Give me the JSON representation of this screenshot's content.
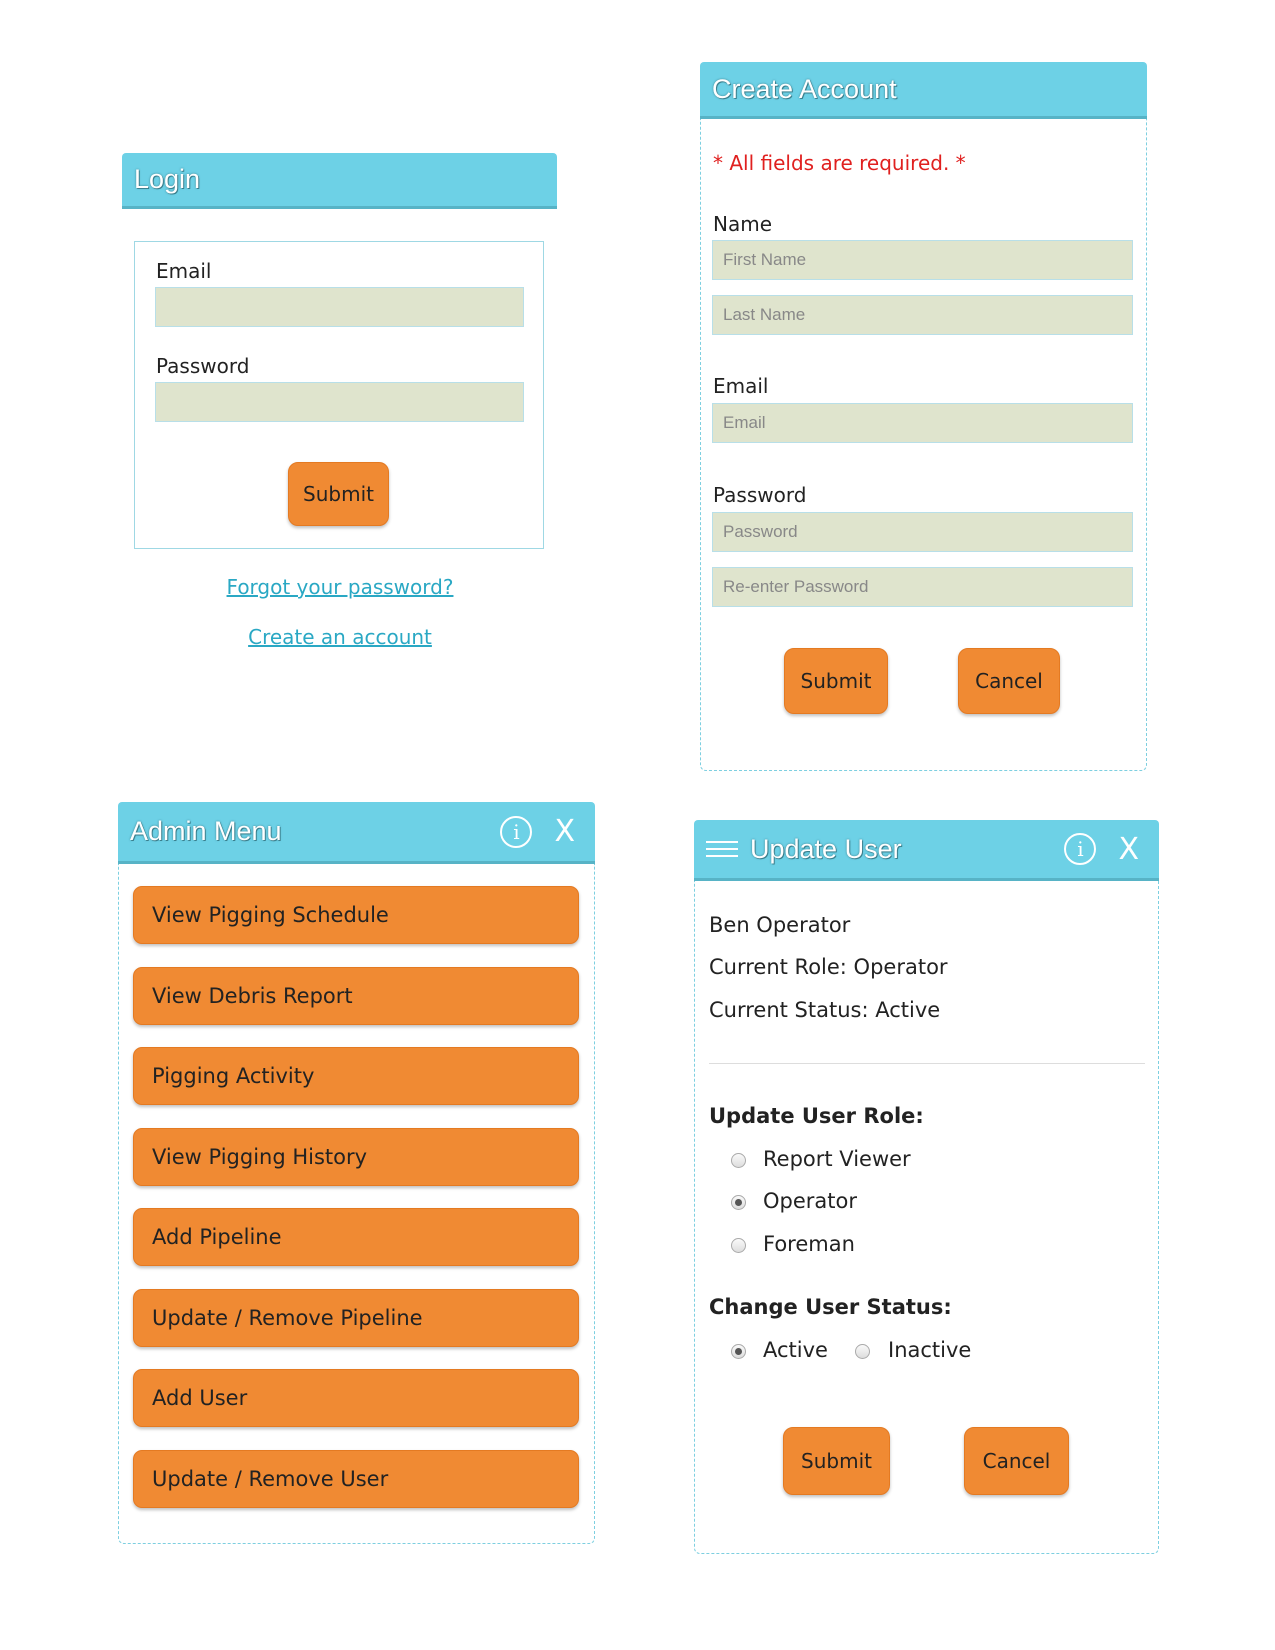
{
  "login": {
    "title": "Login",
    "email_label": "Email",
    "email_value": "",
    "password_label": "Password",
    "password_value": "",
    "submit_label": "Submit",
    "forgot_link": "Forgot your password?",
    "create_link": "Create an account"
  },
  "create_account": {
    "title": "Create Account",
    "required_note": "* All fields are required. *",
    "name_label": "Name",
    "first_name_placeholder": "First Name",
    "last_name_placeholder": "Last Name",
    "email_label": "Email",
    "email_placeholder": "Email",
    "password_label": "Password",
    "password_placeholder": "Password",
    "reenter_placeholder": "Re-enter Password",
    "submit_label": "Submit",
    "cancel_label": "Cancel"
  },
  "admin_menu": {
    "title": "Admin Menu",
    "info_icon": "info-icon",
    "close_label": "X",
    "items": [
      "View Pigging Schedule",
      "View Debris Report",
      "Pigging Activity",
      "View Pigging History",
      "Add Pipeline",
      "Update / Remove Pipeline",
      "Add User",
      "Update / Remove User"
    ]
  },
  "update_user": {
    "title": "Update User",
    "close_label": "X",
    "user_name": "Ben Operator",
    "current_role": "Current Role: Operator",
    "current_status": "Current Status: Active",
    "role_heading": "Update User Role:",
    "roles": [
      {
        "label": "Report Viewer",
        "selected": false
      },
      {
        "label": "Operator",
        "selected": true
      },
      {
        "label": "Foreman",
        "selected": false
      }
    ],
    "status_heading": "Change User Status:",
    "statuses": [
      {
        "label": "Active",
        "selected": true
      },
      {
        "label": "Inactive",
        "selected": false
      }
    ],
    "submit_label": "Submit",
    "cancel_label": "Cancel"
  },
  "colors": {
    "header": "#6dd1e6",
    "button": "#f08a33",
    "field": "#dfe4cd",
    "required": "#e0201f",
    "link": "#2aa8c4"
  }
}
